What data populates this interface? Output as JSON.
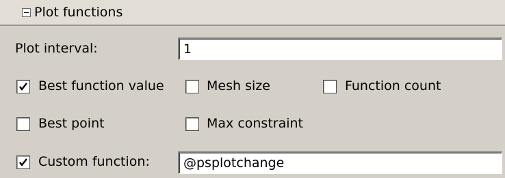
{
  "section": {
    "title": "Plot functions",
    "expanded": true
  },
  "plot_interval": {
    "label": "Plot interval:",
    "value": "1"
  },
  "checkboxes": {
    "best_function_value": {
      "label": "Best function value",
      "checked": true
    },
    "mesh_size": {
      "label": "Mesh size",
      "checked": false
    },
    "function_count": {
      "label": "Function count",
      "checked": false
    },
    "best_point": {
      "label": "Best point",
      "checked": false
    },
    "max_constraint": {
      "label": "Max constraint",
      "checked": false
    },
    "custom_function": {
      "label": "Custom function:",
      "checked": true
    }
  },
  "custom_function_field": {
    "value": "@psplotchange"
  },
  "colors": {
    "panel_bg": "#d4d0c8",
    "header_bg": "#e2ded6"
  }
}
